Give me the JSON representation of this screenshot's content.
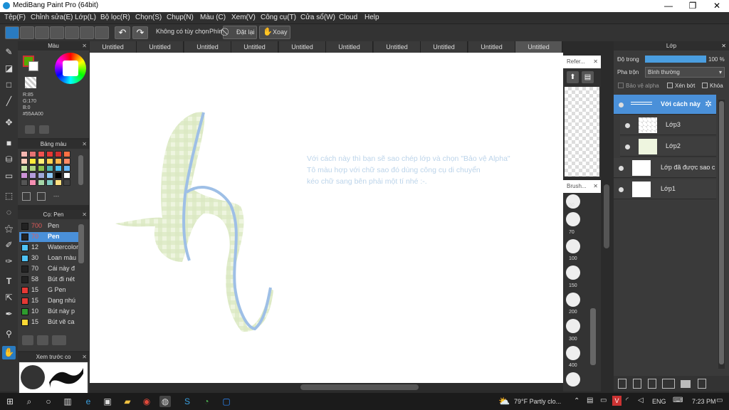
{
  "app": {
    "title": "MediBang Paint Pro (64bit)"
  },
  "window_controls": {
    "minimize": "—",
    "maximize": "❐",
    "close": "✕"
  },
  "menu": [
    "Tệp(F)",
    "Chỉnh sửa(E)",
    "Lớp(L)",
    "Bộ lọc(R)",
    "Chọn(S)",
    "Chụp(N)",
    "Màu (C)",
    "Xem(V)",
    "Công cụ(T)",
    "Cửa sổ(W)",
    "Cloud",
    "Help"
  ],
  "toolbar": {
    "no_option": "Không có tùy chọn",
    "key": "Phím",
    "reset": "Đặt lại",
    "rotate": "Xoay"
  },
  "color_panel": {
    "title": "Màu",
    "rgb": [
      "R:85",
      "G:170",
      "B:0"
    ],
    "hex": "#55AA00",
    "fg_color": "#55aa00",
    "bg_color": "#ffffff"
  },
  "palette_panel": {
    "title": "Bảng màu",
    "dash": "---",
    "colors": [
      "#f5b7b1",
      "#e57373",
      "#ef5350",
      "#e53935",
      "#d32f2f",
      "#ff7043",
      "#ffccbc",
      "#ffeb3b",
      "#fff176",
      "#ffd54f",
      "#ffb74d",
      "#ff8a65",
      "#c5e1a5",
      "#aed581",
      "#8bc34a",
      "#4db6ac",
      "#4fc3f7",
      "#64b5f6",
      "#ce93d8",
      "#b39ddb",
      "#9fa8da",
      "#90caf9",
      "#000000",
      "#ffffff",
      "#555555",
      "#f48fb1",
      "#a5d6a7",
      "#80cbc4",
      "#ffe082",
      "#424242"
    ]
  },
  "brush_panel": {
    "title": "Cọ: Pen",
    "brushes": [
      {
        "size": "700",
        "name": "Pen",
        "color": "#222222"
      },
      {
        "size": "70",
        "name": "Pen",
        "color": "#222222"
      },
      {
        "size": "12",
        "name": "Watercolor",
        "color": "#4fc3f7"
      },
      {
        "size": "30",
        "name": "Loan màu",
        "color": "#4fc3f7"
      },
      {
        "size": "70",
        "name": "Cái này đ",
        "color": "#222222"
      },
      {
        "size": "58",
        "name": "Bút đi nét",
        "color": "#222222"
      },
      {
        "size": "15",
        "name": "G Pen",
        "color": "#e53935"
      },
      {
        "size": "15",
        "name": "Dạng nhú",
        "color": "#e53935"
      },
      {
        "size": "10",
        "name": "Bút này p",
        "color": "#2e9b2e"
      },
      {
        "size": "15",
        "name": "Bút vẽ ca",
        "color": "#fdd835"
      }
    ]
  },
  "preview_panel": {
    "title": "Xem trước co"
  },
  "tabs": [
    "Untitled",
    "Untitled",
    "Untitled",
    "Untitled",
    "Untitled",
    "Untitled",
    "Untitled",
    "Untitled",
    "Untitled",
    "Untitled"
  ],
  "canvas": {
    "text": [
      "Với cách này thì bạn sẽ sao chép lớp và chọn \"Bảo vệ Alpha\"",
      "Tô màu hợp với chữ sao đó dùng công cụ di chuyển",
      "kéo chữ sang bên phải một tí nhé :-."
    ]
  },
  "reference_panel": {
    "title": "Refer..."
  },
  "brush_size_panel": {
    "title": "Brush...",
    "sizes": [
      "50",
      "70",
      "100",
      "150",
      "200",
      "300",
      "400"
    ]
  },
  "layer_panel": {
    "title": "Lớp",
    "opacity_label": "Độ trong",
    "opacity_value": "100 %",
    "opacity_fraction": 1.0,
    "blend_label": "Pha trộn",
    "blend_value": "Bình thường",
    "protect_alpha": "Bảo vệ alpha",
    "clipping": "Xén bớt",
    "lock": "Khóa",
    "layers": [
      {
        "name": "Với cách này",
        "selected": true
      },
      {
        "name": "Lớp3",
        "selected": false
      },
      {
        "name": "Lớp2",
        "selected": false
      },
      {
        "name": "Lớp đã được sao c",
        "selected": false
      },
      {
        "name": "Lớp1",
        "selected": false
      }
    ]
  },
  "taskbar": {
    "weather": "79°F  Partly clo...",
    "ime": "ENG",
    "time": "7:23 PM"
  }
}
